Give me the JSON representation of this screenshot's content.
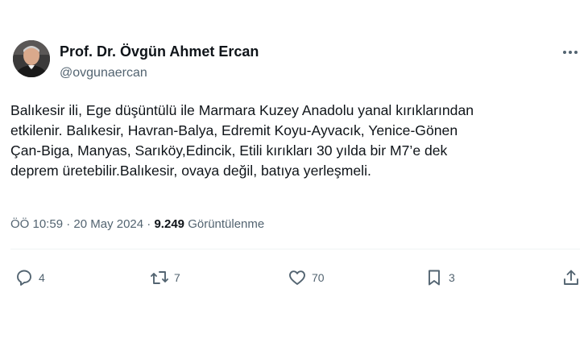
{
  "author": {
    "display_name": "Prof. Dr. Övgün Ahmet Ercan",
    "handle": "@ovgunaercan"
  },
  "tweet": {
    "lines": [
      "Balıkesir ili, Ege düşüntülü ile Marmara Kuzey Anadolu yanal kırıklarından",
      "etkilenir. Balıkesir, Havran-Balya, Edremit Koyu-Ayvacık, Yenice-Gönen",
      "Çan-Biga, Manyas, Sarıköy,Edincik, Etili kırıkları 30 yılda bir M7’e dek",
      "deprem üretebilir.Balıkesir, ovaya değil, batıya yerleşmeli."
    ]
  },
  "meta": {
    "time": "ÖÖ 10:59",
    "separator": "·",
    "date": "20 May 2024",
    "views_count": "9.249",
    "views_label": "Görüntülenme"
  },
  "actions": {
    "replies": "4",
    "reposts": "7",
    "likes": "70",
    "bookmarks": "3"
  },
  "icons": [
    "more-icon",
    "reply-icon",
    "repost-icon",
    "like-icon",
    "bookmark-icon",
    "share-icon"
  ],
  "colors": {
    "text": "#0f1419",
    "secondary": "#536471",
    "divider": "#eff3f4"
  }
}
